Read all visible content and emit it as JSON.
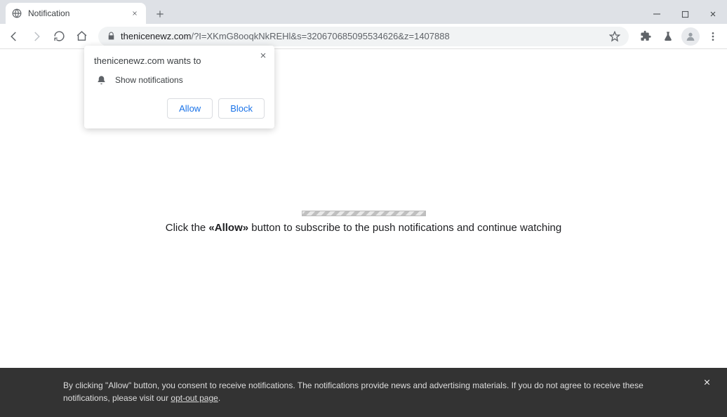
{
  "tab": {
    "title": "Notification"
  },
  "url": {
    "host": "thenicenewz.com",
    "path": "/?I=XKmG8ooqkNkREHl&s=320670685095534626&z=1407888"
  },
  "perm": {
    "origin": "thenicenewz.com wants to",
    "desc": "Show notifications",
    "allow": "Allow",
    "block": "Block"
  },
  "page": {
    "text_pre": "Click the ",
    "text_bold": "«Allow»",
    "text_post": " button to subscribe to the push notifications and continue watching"
  },
  "footer": {
    "text": "By clicking \"Allow\" button, you consent to receive notifications. The notifications provide news and advertising materials. If you do not agree to receive these notifications, please visit our ",
    "link": "opt-out page",
    "dot": "."
  }
}
